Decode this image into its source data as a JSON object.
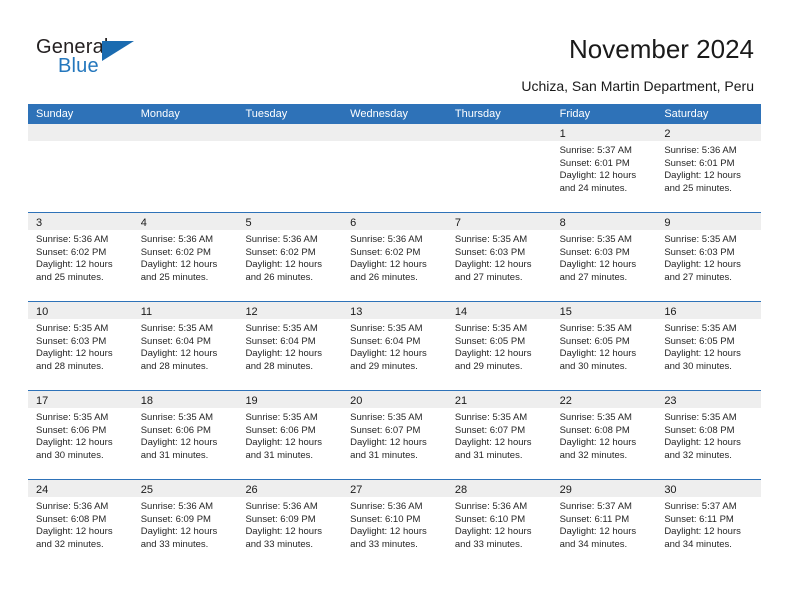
{
  "brand": {
    "name_part1": "General",
    "name_part2": "Blue",
    "accent_color": "#2477bd",
    "flag_icon": "triangle-flag-icon"
  },
  "header": {
    "title": "November 2024",
    "subtitle": "Uchiza, San Martin Department, Peru",
    "header_bar_color": "#2e72b8"
  },
  "calendar": {
    "weekdays": [
      "Sunday",
      "Monday",
      "Tuesday",
      "Wednesday",
      "Thursday",
      "Friday",
      "Saturday"
    ],
    "weeks": [
      [
        {
          "date": "",
          "lines": []
        },
        {
          "date": "",
          "lines": []
        },
        {
          "date": "",
          "lines": []
        },
        {
          "date": "",
          "lines": []
        },
        {
          "date": "",
          "lines": []
        },
        {
          "date": "1",
          "lines": [
            "Sunrise: 5:37 AM",
            "Sunset: 6:01 PM",
            "Daylight: 12 hours",
            "and 24 minutes."
          ]
        },
        {
          "date": "2",
          "lines": [
            "Sunrise: 5:36 AM",
            "Sunset: 6:01 PM",
            "Daylight: 12 hours",
            "and 25 minutes."
          ]
        }
      ],
      [
        {
          "date": "3",
          "lines": [
            "Sunrise: 5:36 AM",
            "Sunset: 6:02 PM",
            "Daylight: 12 hours",
            "and 25 minutes."
          ]
        },
        {
          "date": "4",
          "lines": [
            "Sunrise: 5:36 AM",
            "Sunset: 6:02 PM",
            "Daylight: 12 hours",
            "and 25 minutes."
          ]
        },
        {
          "date": "5",
          "lines": [
            "Sunrise: 5:36 AM",
            "Sunset: 6:02 PM",
            "Daylight: 12 hours",
            "and 26 minutes."
          ]
        },
        {
          "date": "6",
          "lines": [
            "Sunrise: 5:36 AM",
            "Sunset: 6:02 PM",
            "Daylight: 12 hours",
            "and 26 minutes."
          ]
        },
        {
          "date": "7",
          "lines": [
            "Sunrise: 5:35 AM",
            "Sunset: 6:03 PM",
            "Daylight: 12 hours",
            "and 27 minutes."
          ]
        },
        {
          "date": "8",
          "lines": [
            "Sunrise: 5:35 AM",
            "Sunset: 6:03 PM",
            "Daylight: 12 hours",
            "and 27 minutes."
          ]
        },
        {
          "date": "9",
          "lines": [
            "Sunrise: 5:35 AM",
            "Sunset: 6:03 PM",
            "Daylight: 12 hours",
            "and 27 minutes."
          ]
        }
      ],
      [
        {
          "date": "10",
          "lines": [
            "Sunrise: 5:35 AM",
            "Sunset: 6:03 PM",
            "Daylight: 12 hours",
            "and 28 minutes."
          ]
        },
        {
          "date": "11",
          "lines": [
            "Sunrise: 5:35 AM",
            "Sunset: 6:04 PM",
            "Daylight: 12 hours",
            "and 28 minutes."
          ]
        },
        {
          "date": "12",
          "lines": [
            "Sunrise: 5:35 AM",
            "Sunset: 6:04 PM",
            "Daylight: 12 hours",
            "and 28 minutes."
          ]
        },
        {
          "date": "13",
          "lines": [
            "Sunrise: 5:35 AM",
            "Sunset: 6:04 PM",
            "Daylight: 12 hours",
            "and 29 minutes."
          ]
        },
        {
          "date": "14",
          "lines": [
            "Sunrise: 5:35 AM",
            "Sunset: 6:05 PM",
            "Daylight: 12 hours",
            "and 29 minutes."
          ]
        },
        {
          "date": "15",
          "lines": [
            "Sunrise: 5:35 AM",
            "Sunset: 6:05 PM",
            "Daylight: 12 hours",
            "and 30 minutes."
          ]
        },
        {
          "date": "16",
          "lines": [
            "Sunrise: 5:35 AM",
            "Sunset: 6:05 PM",
            "Daylight: 12 hours",
            "and 30 minutes."
          ]
        }
      ],
      [
        {
          "date": "17",
          "lines": [
            "Sunrise: 5:35 AM",
            "Sunset: 6:06 PM",
            "Daylight: 12 hours",
            "and 30 minutes."
          ]
        },
        {
          "date": "18",
          "lines": [
            "Sunrise: 5:35 AM",
            "Sunset: 6:06 PM",
            "Daylight: 12 hours",
            "and 31 minutes."
          ]
        },
        {
          "date": "19",
          "lines": [
            "Sunrise: 5:35 AM",
            "Sunset: 6:06 PM",
            "Daylight: 12 hours",
            "and 31 minutes."
          ]
        },
        {
          "date": "20",
          "lines": [
            "Sunrise: 5:35 AM",
            "Sunset: 6:07 PM",
            "Daylight: 12 hours",
            "and 31 minutes."
          ]
        },
        {
          "date": "21",
          "lines": [
            "Sunrise: 5:35 AM",
            "Sunset: 6:07 PM",
            "Daylight: 12 hours",
            "and 31 minutes."
          ]
        },
        {
          "date": "22",
          "lines": [
            "Sunrise: 5:35 AM",
            "Sunset: 6:08 PM",
            "Daylight: 12 hours",
            "and 32 minutes."
          ]
        },
        {
          "date": "23",
          "lines": [
            "Sunrise: 5:35 AM",
            "Sunset: 6:08 PM",
            "Daylight: 12 hours",
            "and 32 minutes."
          ]
        }
      ],
      [
        {
          "date": "24",
          "lines": [
            "Sunrise: 5:36 AM",
            "Sunset: 6:08 PM",
            "Daylight: 12 hours",
            "and 32 minutes."
          ]
        },
        {
          "date": "25",
          "lines": [
            "Sunrise: 5:36 AM",
            "Sunset: 6:09 PM",
            "Daylight: 12 hours",
            "and 33 minutes."
          ]
        },
        {
          "date": "26",
          "lines": [
            "Sunrise: 5:36 AM",
            "Sunset: 6:09 PM",
            "Daylight: 12 hours",
            "and 33 minutes."
          ]
        },
        {
          "date": "27",
          "lines": [
            "Sunrise: 5:36 AM",
            "Sunset: 6:10 PM",
            "Daylight: 12 hours",
            "and 33 minutes."
          ]
        },
        {
          "date": "28",
          "lines": [
            "Sunrise: 5:36 AM",
            "Sunset: 6:10 PM",
            "Daylight: 12 hours",
            "and 33 minutes."
          ]
        },
        {
          "date": "29",
          "lines": [
            "Sunrise: 5:37 AM",
            "Sunset: 6:11 PM",
            "Daylight: 12 hours",
            "and 34 minutes."
          ]
        },
        {
          "date": "30",
          "lines": [
            "Sunrise: 5:37 AM",
            "Sunset: 6:11 PM",
            "Daylight: 12 hours",
            "and 34 minutes."
          ]
        }
      ]
    ]
  }
}
